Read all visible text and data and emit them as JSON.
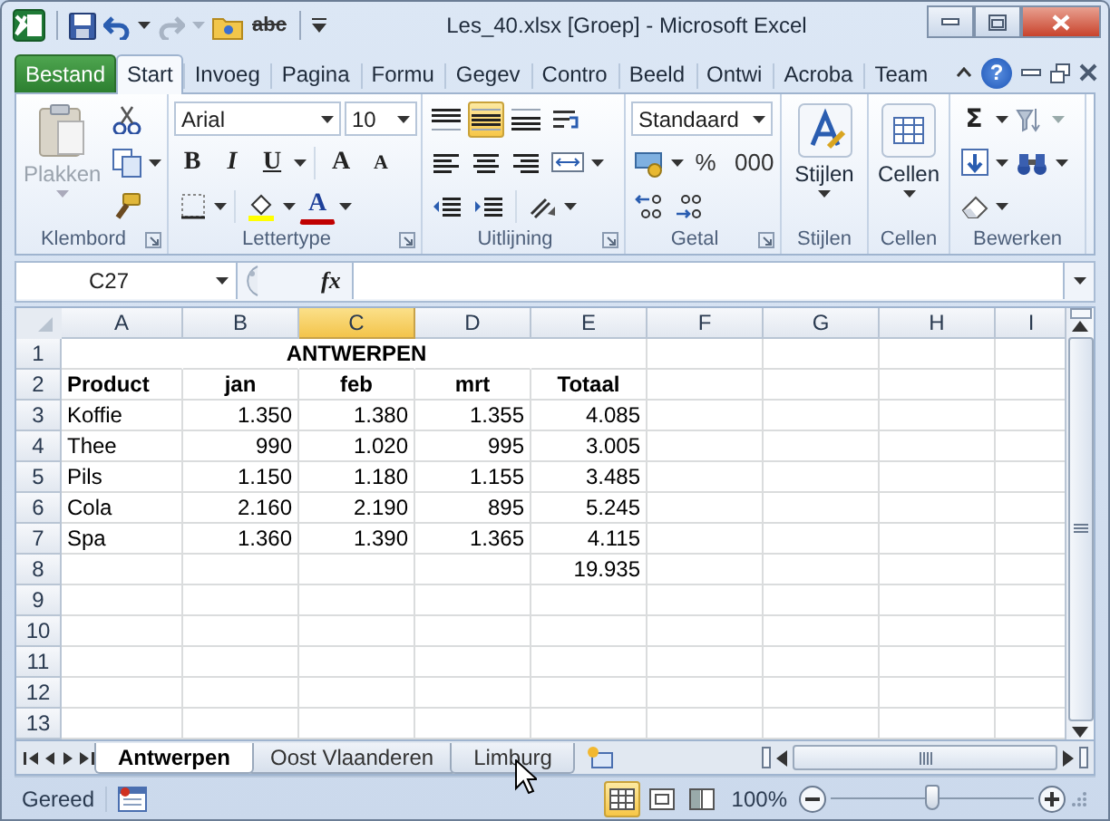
{
  "window": {
    "title": "Les_40.xlsx  [Groep]  -  Microsoft Excel"
  },
  "quick_access": {
    "spelling_label": "abc",
    "redo_disabled": true
  },
  "file_tab": {
    "label": "Bestand"
  },
  "ribbon_tabs": [
    {
      "label": "Start",
      "selected": true
    },
    {
      "label": "Invoeg",
      "selected": false
    },
    {
      "label": "Pagina",
      "selected": false
    },
    {
      "label": "Formu",
      "selected": false
    },
    {
      "label": "Gegev",
      "selected": false
    },
    {
      "label": "Contro",
      "selected": false
    },
    {
      "label": "Beeld",
      "selected": false
    },
    {
      "label": "Ontwi",
      "selected": false
    },
    {
      "label": "Acroba",
      "selected": false
    },
    {
      "label": "Team",
      "selected": false
    }
  ],
  "help": {
    "label": "?"
  },
  "ribbon_groups": [
    {
      "kind": "clipboard",
      "label": "Klembord",
      "paste_label": "Plakken",
      "paste_disabled": true
    },
    {
      "kind": "font",
      "label": "Lettertype",
      "font": "Arial",
      "size": "10",
      "styles": [
        "B",
        "I",
        "U"
      ],
      "grow_glyph": "A",
      "shrink_glyph": "A",
      "color_glyph": "A"
    },
    {
      "kind": "alignment",
      "label": "Uitlijning",
      "vertical_align": [
        {
          "selected": false
        },
        {
          "selected": true
        },
        {
          "selected": false
        }
      ]
    },
    {
      "kind": "number",
      "label": "Getal",
      "format": "Standaard",
      "percent": "%",
      "thousands": "000"
    },
    {
      "kind": "styles",
      "label": "Stijlen",
      "button_label": "Stijlen"
    },
    {
      "kind": "cells",
      "label": "Cellen",
      "button_label": "Cellen"
    },
    {
      "kind": "editing",
      "label": "Bewerken",
      "sum_glyph": "Σ"
    }
  ],
  "formula_bar": {
    "name_box": "C27",
    "function_label": "fx"
  },
  "sheet": {
    "columns": [
      {
        "label": "A",
        "selected": false
      },
      {
        "label": "B",
        "selected": false
      },
      {
        "label": "C",
        "selected": true
      },
      {
        "label": "D",
        "selected": false
      },
      {
        "label": "E",
        "selected": false
      },
      {
        "label": "F",
        "selected": false
      },
      {
        "label": "G",
        "selected": false
      },
      {
        "label": "H",
        "selected": false
      },
      {
        "label": "I",
        "selected": false
      }
    ],
    "rows": [
      {
        "number": "1",
        "kind": "title",
        "cells": [
          null,
          null,
          "ANTWERPEN",
          null,
          null
        ]
      },
      {
        "number": "2",
        "kind": "header",
        "cells": [
          "Product",
          "jan",
          "feb",
          "mrt",
          "Totaal"
        ]
      },
      {
        "number": "3",
        "kind": "data",
        "cells": [
          "Koffie",
          "1.350",
          "1.380",
          "1.355",
          "4.085"
        ]
      },
      {
        "number": "4",
        "kind": "data",
        "cells": [
          "Thee",
          "990",
          "1.020",
          "995",
          "3.005"
        ]
      },
      {
        "number": "5",
        "kind": "data",
        "cells": [
          "Pils",
          "1.150",
          "1.180",
          "1.155",
          "3.485"
        ]
      },
      {
        "number": "6",
        "kind": "data",
        "cells": [
          "Cola",
          "2.160",
          "2.190",
          "895",
          "5.245"
        ]
      },
      {
        "number": "7",
        "kind": "data",
        "cells": [
          "Spa",
          "1.360",
          "1.390",
          "1.365",
          "4.115"
        ]
      },
      {
        "number": "8",
        "kind": "data",
        "cells": [
          null,
          null,
          null,
          null,
          "19.935"
        ]
      },
      {
        "number": "9",
        "kind": "data",
        "cells": []
      },
      {
        "number": "10",
        "kind": "data",
        "cells": []
      },
      {
        "number": "11",
        "kind": "data",
        "cells": []
      },
      {
        "number": "12",
        "kind": "data",
        "cells": []
      },
      {
        "number": "13",
        "kind": "data",
        "cells": []
      }
    ]
  },
  "sheet_tabs": [
    {
      "label": "Antwerpen",
      "selected": true
    },
    {
      "label": "Oost Vlaanderen",
      "selected": false
    },
    {
      "label": "Limburg",
      "selected": false
    }
  ],
  "status_bar": {
    "status": "Gereed",
    "views": [
      {
        "selected": true
      },
      {
        "selected": false
      },
      {
        "selected": false
      }
    ],
    "zoom": "100%",
    "zoom_slider": {
      "level": 0.5
    }
  }
}
